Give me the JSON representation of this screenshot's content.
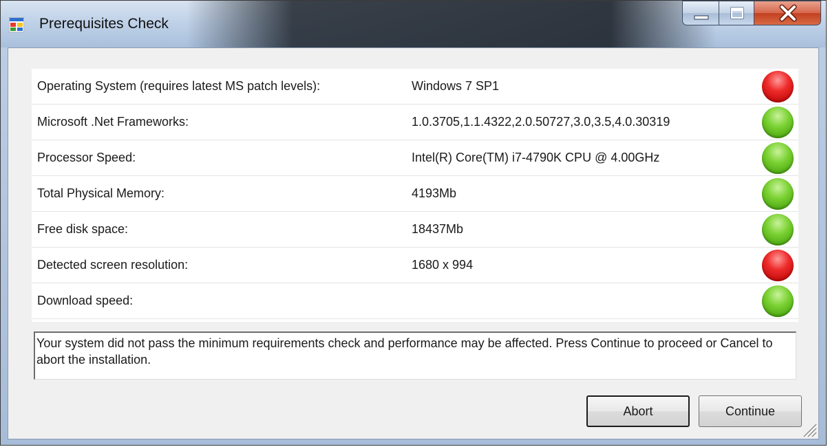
{
  "window": {
    "title": "Prerequisites Check",
    "icon": "app-window-icon",
    "controls": {
      "minimize_icon": "minimize-icon",
      "maximize_icon": "maximize-icon",
      "close_icon": "close-icon"
    }
  },
  "checks": [
    {
      "label": "Operating System (requires latest MS patch levels):",
      "value": "Windows 7 SP1",
      "status": "fail"
    },
    {
      "label": "Microsoft .Net Frameworks:",
      "value": "1.0.3705,1.1.4322,2.0.50727,3.0,3.5,4.0.30319",
      "status": "pass"
    },
    {
      "label": "Processor Speed:",
      "value": "Intel(R) Core(TM) i7-4790K CPU @ 4.00GHz",
      "status": "pass"
    },
    {
      "label": "Total Physical Memory:",
      "value": "4193Mb",
      "status": "pass"
    },
    {
      "label": "Free disk space:",
      "value": "18437Mb",
      "status": "pass"
    },
    {
      "label": "Detected screen resolution:",
      "value": "1680 x 994",
      "status": "fail"
    },
    {
      "label": "Download speed:",
      "value": "",
      "status": "pass"
    }
  ],
  "message": "Your system did not pass the minimum requirements check and performance may be affected. Press Continue to proceed or Cancel to abort the installation.",
  "buttons": {
    "abort_label": "Abort",
    "continue_label": "Continue"
  },
  "colors": {
    "pass": "#5cb81c",
    "fail": "#e01c1c"
  }
}
